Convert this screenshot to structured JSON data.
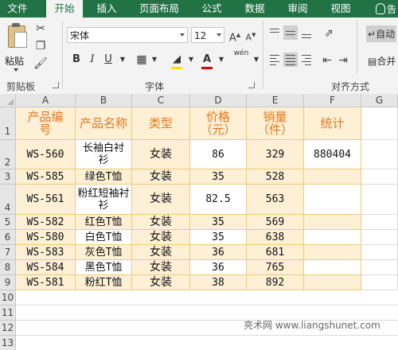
{
  "ribbon": {
    "tabs": [
      "文件",
      "开始",
      "插入",
      "页面布局",
      "公式",
      "数据",
      "审阅",
      "视图"
    ],
    "tell_me": "告",
    "clipboard": {
      "paste_label": "粘贴",
      "group_label": "剪贴板"
    },
    "font": {
      "name": "宋体",
      "size": "12",
      "group_label": "字体",
      "wen": "wén",
      "bold": "B",
      "italic": "I",
      "underline": "U",
      "grow": "A",
      "shrink": "A",
      "font_color_letter": "A",
      "font_color": "#e00000",
      "fill_color": "#ffe000"
    },
    "alignment": {
      "group_label": "对齐方式",
      "wrap_label": "自动",
      "merge_label": "合并"
    }
  },
  "sheet": {
    "columns": [
      "A",
      "B",
      "C",
      "D",
      "E",
      "F",
      "G"
    ],
    "rows": [
      "1",
      "2",
      "3",
      "4",
      "5",
      "6",
      "7",
      "8",
      "9",
      "10",
      "11",
      "12",
      "13"
    ],
    "header": [
      "产品编号",
      "产品名称",
      "类型",
      "价格（元）",
      "销量（件）",
      "统计"
    ],
    "data": [
      [
        "WS-560",
        "长袖白衬衫",
        "女装",
        "86",
        "329",
        "880404"
      ],
      [
        "WS-585",
        "绿色T恤",
        "女装",
        "35",
        "528",
        ""
      ],
      [
        "WS-561",
        "粉红短袖衬衫",
        "女装",
        "82.5",
        "563",
        ""
      ],
      [
        "WS-582",
        "红色T恤",
        "女装",
        "35",
        "569",
        ""
      ],
      [
        "WS-580",
        "白色T恤",
        "女装",
        "35",
        "638",
        ""
      ],
      [
        "WS-583",
        "灰色T恤",
        "女装",
        "36",
        "681",
        ""
      ],
      [
        "WS-584",
        "黑色T恤",
        "女装",
        "36",
        "765",
        ""
      ],
      [
        "WS-581",
        "粉红T恤",
        "女装",
        "38",
        "892",
        ""
      ]
    ]
  },
  "watermark": "亮术网 www.liangshunet.com",
  "colors": {
    "ribbon_green": "#217346",
    "header_text": "#e8761b",
    "table_fill": "#fdf0d5",
    "table_border": "#f2c97a"
  }
}
